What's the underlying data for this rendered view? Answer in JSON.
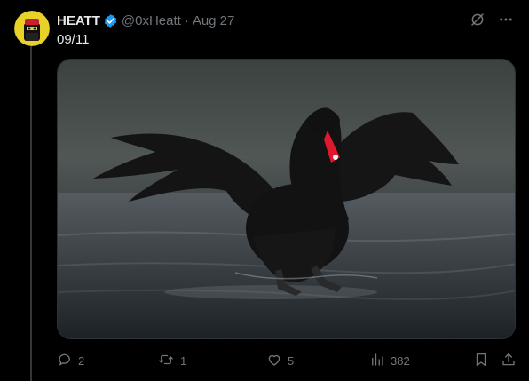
{
  "tweet": {
    "author_name": "HEATT",
    "handle": "@0xHeatt",
    "separator": "·",
    "date": "Aug 27",
    "text": "09/11"
  },
  "icons": {
    "verified": "verified-badge-icon",
    "grok": "grok-icon",
    "more": "more-icon",
    "reply": "reply-icon",
    "retweet": "retweet-icon",
    "like": "like-icon",
    "views": "views-icon",
    "bookmark": "bookmark-icon",
    "share": "share-icon"
  },
  "stats": {
    "replies": "2",
    "retweets": "1",
    "likes": "5",
    "views": "382"
  },
  "colors": {
    "verified_blue": "#1d9bf0",
    "secondary_text": "#71767b",
    "background": "#000000"
  }
}
